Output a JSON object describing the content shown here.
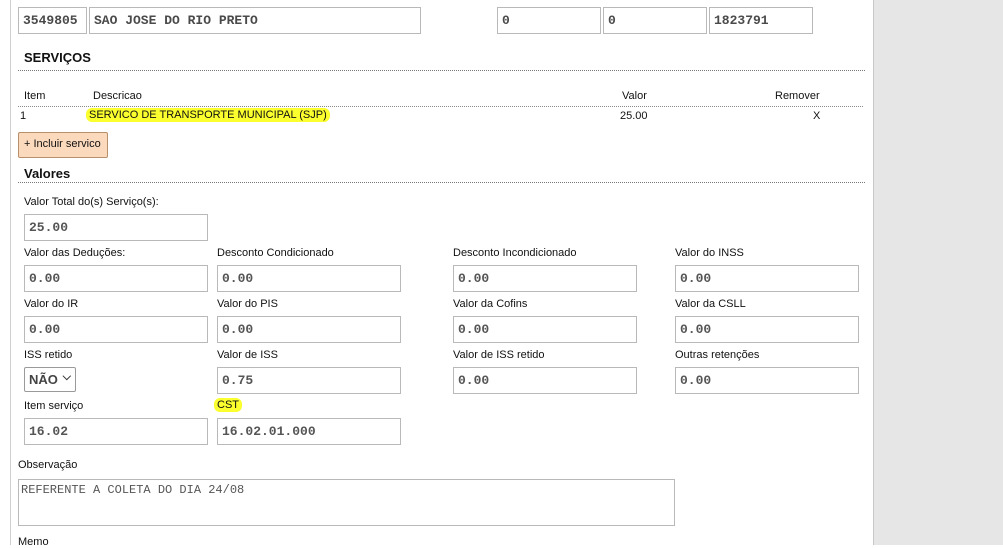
{
  "header_row": {
    "municipio_code": "3549805",
    "municipio_name": "SAO JOSE DO RIO PRETO",
    "field_a": "0",
    "field_b": "0",
    "field_c": "1823791"
  },
  "servicos": {
    "title": "SERVIÇOS",
    "columns": {
      "item": "Item",
      "descricao": "Descricao",
      "valor": "Valor",
      "remover": "Remover"
    },
    "rows": [
      {
        "item": "1",
        "descricao": "SERVICO DE TRANSPORTE MUNICIPAL (SJP)",
        "valor": "25.00",
        "remover": "X"
      }
    ],
    "add_button": "+ Incluir servico"
  },
  "valores": {
    "title": "Valores",
    "total_label": "Valor Total do(s) Serviço(s):",
    "total_value": "25.00",
    "fields": {
      "deducoes": {
        "label": "Valor das Deduções:",
        "value": "0.00"
      },
      "desc_cond": {
        "label": "Desconto Condicionado",
        "value": "0.00"
      },
      "desc_incond": {
        "label": "Desconto Incondicionado",
        "value": "0.00"
      },
      "inss": {
        "label": "Valor do INSS",
        "value": "0.00"
      },
      "ir": {
        "label": "Valor do IR",
        "value": "0.00"
      },
      "pis": {
        "label": "Valor do PIS",
        "value": "0.00"
      },
      "cofins": {
        "label": "Valor da Cofins",
        "value": "0.00"
      },
      "csll": {
        "label": "Valor da CSLL",
        "value": "0.00"
      },
      "iss_retido": {
        "label": "ISS retido",
        "value": "NÃO"
      },
      "valor_iss": {
        "label": "Valor de ISS",
        "value": "0.75"
      },
      "valor_iss_retido": {
        "label": "Valor de ISS retido",
        "value": "0.00"
      },
      "outras": {
        "label": "Outras retenções",
        "value": "0.00"
      },
      "item_servico": {
        "label": "Item serviço",
        "value": "16.02"
      },
      "cst": {
        "label": "CST",
        "value": "16.02.01.000"
      }
    }
  },
  "observacao": {
    "label": "Observação",
    "value": "REFERENTE A COLETA DO DIA 24/08"
  },
  "memo": {
    "label": "Memo"
  },
  "colors": {
    "highlight": "#fbff2e",
    "button_bg": "#fbd9bd",
    "right_panel": "#e6e6e6"
  }
}
